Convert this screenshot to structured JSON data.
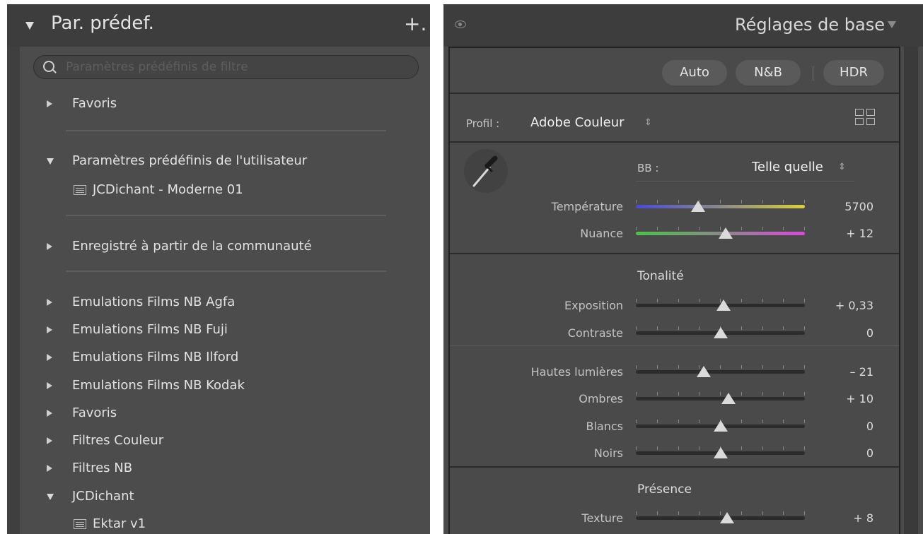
{
  "left_panel": {
    "title": "Par. prédef.",
    "add_label": "+.",
    "search_placeholder": "Paramètres prédéfinis de filtre",
    "favoris_top": "Favoris",
    "user_presets": "Paramètres prédéfinis de l'utilisateur",
    "user_preset_item": "JCDichant - Moderne 01",
    "community": "Enregistré à partir de la communauté",
    "groups": [
      "Emulations Films NB Agfa",
      "Emulations Films NB Fuji",
      "Emulations Films NB Ilford",
      "Emulations Films NB Kodak",
      "Favoris",
      "Filtres Couleur",
      "Filtres NB"
    ],
    "jcd_group": "JCDichant",
    "jcd_item": "Ektar v1"
  },
  "right_panel": {
    "title": "Réglages de base",
    "buttons": {
      "auto": "Auto",
      "nb": "N&B",
      "hdr": "HDR"
    },
    "profile_label": "Profil :",
    "profile_value": "Adobe Couleur",
    "wb_label": "BB :",
    "wb_value": "Telle quelle",
    "sections": {
      "tonality": "Tonalité",
      "presence": "Présence"
    },
    "sliders": {
      "temperature": {
        "label": "Température",
        "value": "5700",
        "position": 0.37,
        "track_color": "gradient-blue-yellow"
      },
      "tint": {
        "label": "Nuance",
        "value": "+ 12",
        "position": 0.53,
        "track_color": "gradient-green-magenta"
      },
      "exposure": {
        "label": "Exposition",
        "value": "+ 0,33",
        "position": 0.52
      },
      "contrast": {
        "label": "Contraste",
        "value": "0",
        "position": 0.5
      },
      "highlights": {
        "label": "Hautes lumières",
        "value": "– 21",
        "position": 0.4
      },
      "shadows": {
        "label": "Ombres",
        "value": "+ 10",
        "position": 0.55
      },
      "whites": {
        "label": "Blancs",
        "value": "0",
        "position": 0.5
      },
      "blacks": {
        "label": "Noirs",
        "value": "0",
        "position": 0.5
      },
      "texture": {
        "label": "Texture",
        "value": "+ 8",
        "position": 0.54
      }
    }
  },
  "colors": {
    "panel_bg": "#4c4c4c",
    "header_bg": "#3d3d3d",
    "text": "#e2e2e2",
    "accent_thumb": "#dadada"
  }
}
